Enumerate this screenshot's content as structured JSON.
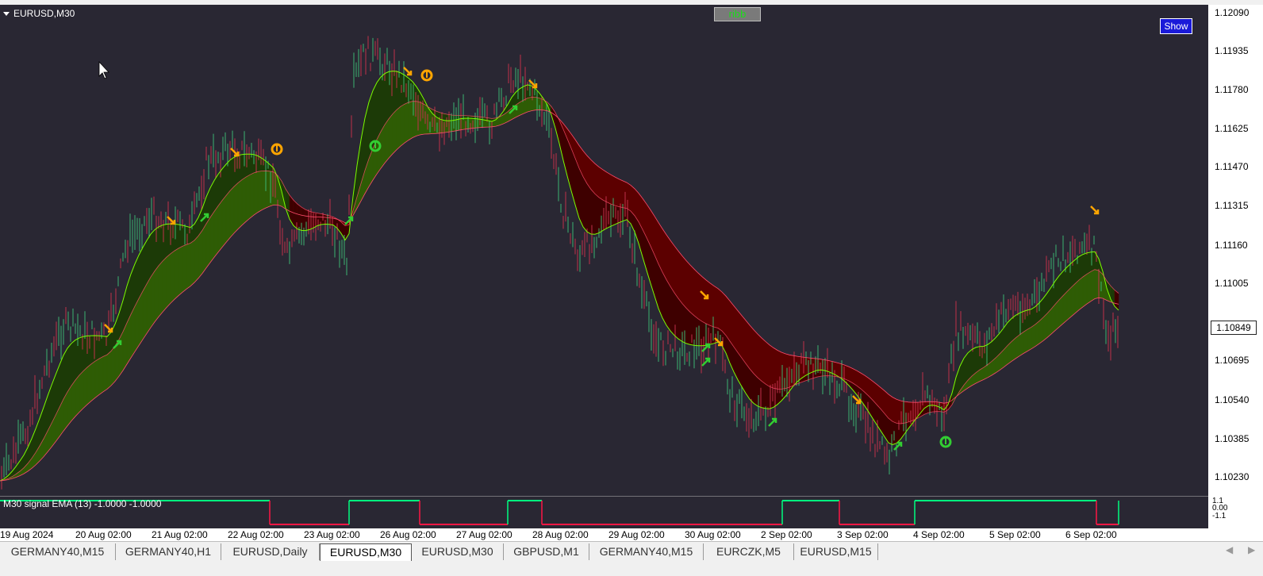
{
  "chart": {
    "symbol_title": "EURUSD,M30",
    "ribb_button": "ribb",
    "show_button": "Show",
    "current_price": "1.10849",
    "price_labels": [
      "1.12090",
      "1.11935",
      "1.11780",
      "1.11625",
      "1.11470",
      "1.11315",
      "1.11160",
      "1.11005",
      "1.10849",
      "1.10695",
      "1.10540",
      "1.10385",
      "1.10230"
    ],
    "indicator_label": "M30 signal EMA (13) -1.0000 -1.0000",
    "indicator_axis": [
      "1.1",
      "0.00",
      "-1.1"
    ],
    "time_labels": [
      "19 Aug 2024",
      "20 Aug 02:00",
      "21 Aug 02:00",
      "22 Aug 02:00",
      "23 Aug 02:00",
      "26 Aug 02:00",
      "27 Aug 02:00",
      "28 Aug 02:00",
      "29 Aug 02:00",
      "30 Aug 02:00",
      "2 Sep 02:00",
      "3 Sep 02:00",
      "4 Sep 02:00",
      "5 Sep 02:00",
      "6 Sep 02:00"
    ],
    "colors": {
      "background": "#292733",
      "bull_band": "#2e5c05",
      "bull_band_dark": "#1c3a07",
      "bear_band": "#5c0000",
      "fast_line_bull": "#7cfc00",
      "line_bear": "#ff4d6d",
      "arrow_up": "#32cd32",
      "arrow_down": "#ffa500",
      "signal_up": "#00ff7f",
      "signal_down": "#ff1744"
    },
    "icons": [
      "arrow-up-icon",
      "arrow-down-icon",
      "exit-signal-icon"
    ]
  },
  "tabs": [
    {
      "label": "GERMANY40,M15",
      "active": false
    },
    {
      "label": "GERMANY40,H1",
      "active": false
    },
    {
      "label": "EURUSD,Daily",
      "active": false
    },
    {
      "label": "EURUSD,M30",
      "active": true
    },
    {
      "label": "EURUSD,M30",
      "active": false
    },
    {
      "label": "GBPUSD,M1",
      "active": false
    },
    {
      "label": "GERMANY40,M15",
      "active": false
    },
    {
      "label": "EURCZK,M5",
      "active": false
    },
    {
      "label": "EURUSD,M15",
      "active": false
    }
  ]
}
